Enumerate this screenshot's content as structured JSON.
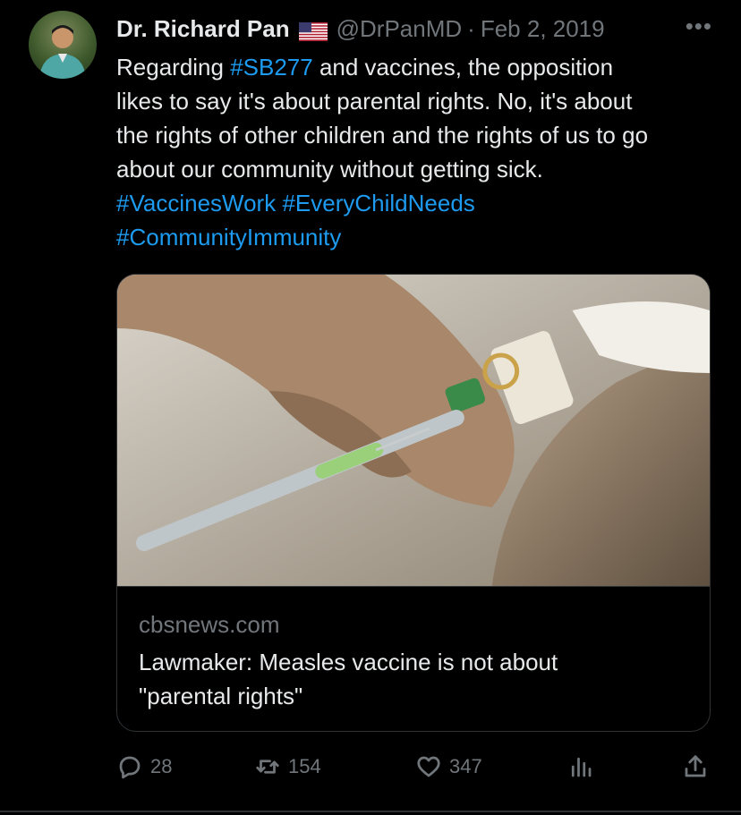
{
  "author": {
    "name": "Dr. Richard Pan",
    "handle": "@DrPanMD",
    "separator": "·",
    "date": "Feb 2, 2019",
    "flag_icon": "us-flag-icon"
  },
  "more_icon": "more-options-icon",
  "tweet": {
    "segments": [
      {
        "text": "Regarding ",
        "hashtag": false
      },
      {
        "text": "#SB277",
        "hashtag": true
      },
      {
        "text": " and vaccines, the opposition\nlikes to say it's about parental rights. No, it's about\nthe rights of other children and the rights of us to go\nabout our community without getting sick.\n",
        "hashtag": false
      },
      {
        "text": "#VaccinesWork",
        "hashtag": true
      },
      {
        "text": " ",
        "hashtag": false
      },
      {
        "text": "#EveryChildNeeds",
        "hashtag": true
      },
      {
        "text": "\n",
        "hashtag": false
      },
      {
        "text": "#CommunityImmunity",
        "hashtag": true
      }
    ]
  },
  "link_card": {
    "domain": "cbsnews.com",
    "title": "Lawmaker: Measles vaccine is not about\n\"parental rights\""
  },
  "actions": {
    "reply_count": "28",
    "retweet_count": "154",
    "like_count": "347"
  },
  "colors": {
    "background": "#000000",
    "text": "#e7e9ea",
    "muted": "#71767b",
    "link": "#1d9bf0",
    "border": "#2f3336"
  }
}
